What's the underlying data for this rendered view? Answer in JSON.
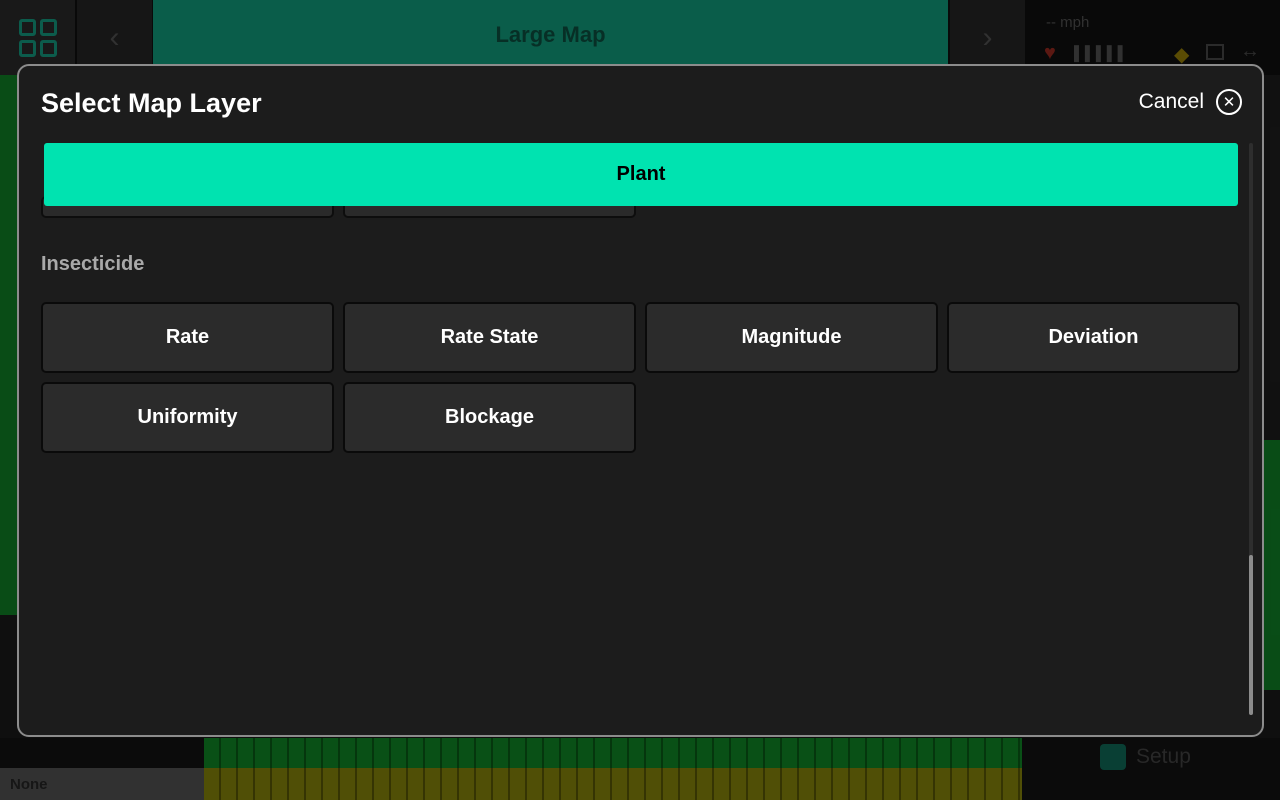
{
  "background": {
    "map_title": "Large Map",
    "speed": "-- mph",
    "layer_none": "None",
    "setup_label": "Setup",
    "nav_prev": "‹",
    "nav_next": "›"
  },
  "modal": {
    "title": "Select Map Layer",
    "cancel_label": "Cancel",
    "selected_layer": "Plant",
    "sections": [
      {
        "label": "Insecticide",
        "options": [
          "Rate",
          "Rate State",
          "Magnitude",
          "Deviation",
          "Uniformity",
          "Blockage"
        ]
      }
    ]
  },
  "colors": {
    "accent": "#00e3b0",
    "modal_bg": "#1c1c1c",
    "button_bg": "#2b2b2b"
  }
}
